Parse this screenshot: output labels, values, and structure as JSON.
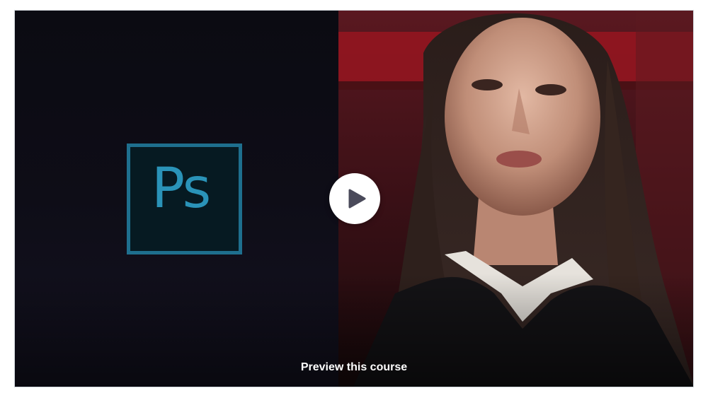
{
  "preview": {
    "label": "Preview this course",
    "play_icon": "play-icon"
  },
  "thumbnail": {
    "logo_text": "Ps",
    "logo_icon": "photoshop-logo-icon",
    "photo": "portrait-photo"
  },
  "colors": {
    "logo_border": "#1e6f8e",
    "logo_text": "#2a93b8",
    "left_bg": "#0b0b12",
    "play_bg": "#ffffff",
    "play_icon": "#4a4a5a"
  }
}
